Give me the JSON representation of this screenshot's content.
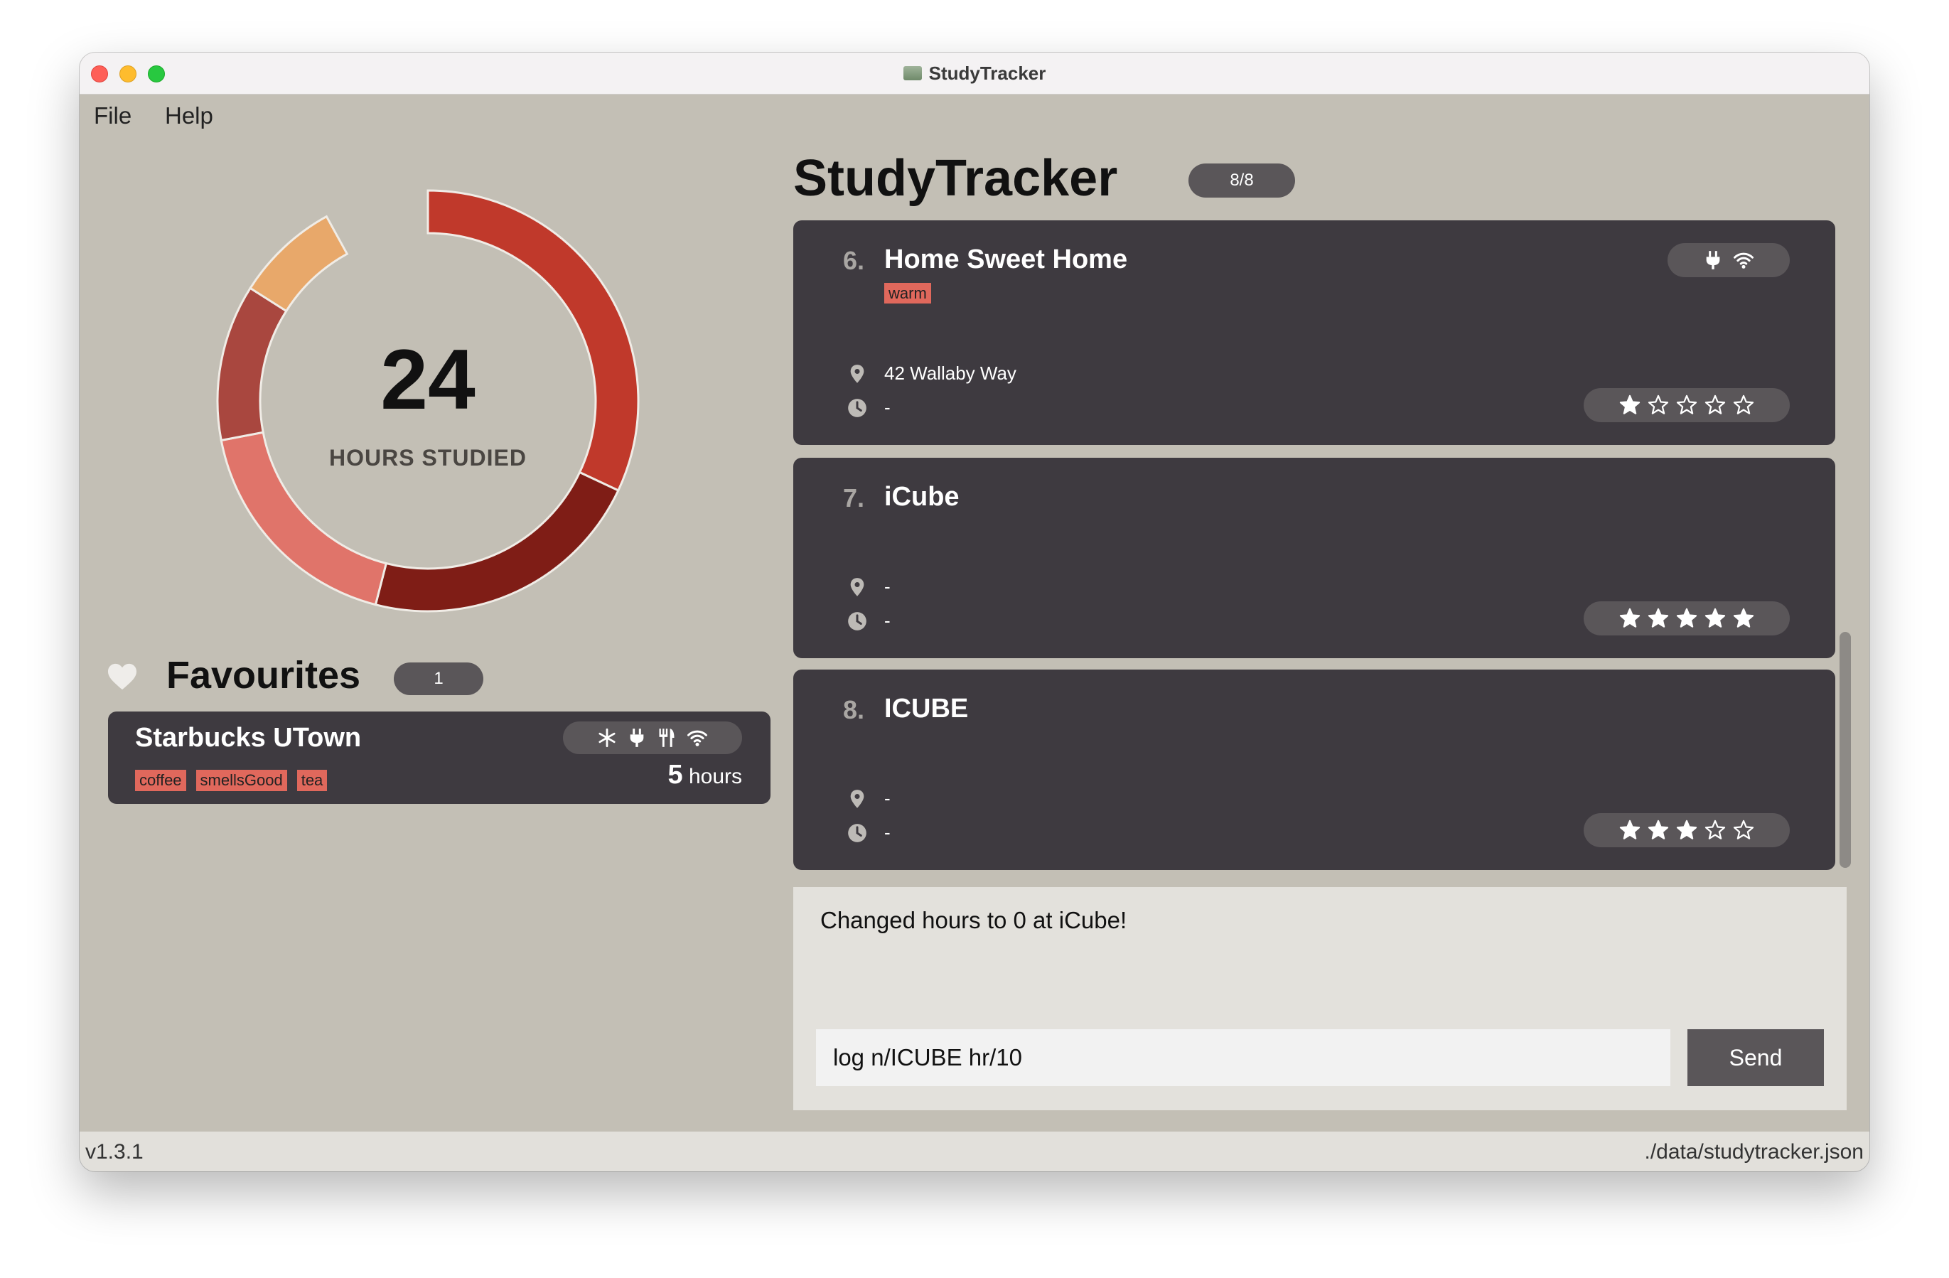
{
  "window": {
    "title": "StudyTracker"
  },
  "menu": {
    "file": "File",
    "help": "Help"
  },
  "summary": {
    "hours": "24",
    "caption": "HOURS STUDIED",
    "segments": [
      {
        "color": "#c0392b",
        "fraction": 0.32
      },
      {
        "color": "#7f1d16",
        "fraction": 0.22
      },
      {
        "color": "#e0746a",
        "fraction": 0.18
      },
      {
        "color": "#a9473f",
        "fraction": 0.12
      },
      {
        "color": "#e8a86a",
        "fraction": 0.08
      }
    ]
  },
  "favourites": {
    "title": "Favourites",
    "count": "1",
    "items": [
      {
        "name": "Starbucks UTown",
        "tags": [
          "coffee",
          "smellsGood",
          "tea"
        ],
        "hours": "5",
        "hours_label": "hours",
        "amenities": [
          "snowflake-icon",
          "plug-icon",
          "food-icon",
          "wifi-icon"
        ]
      }
    ]
  },
  "list": {
    "title": "StudyTracker",
    "count": "8/8",
    "cards": [
      {
        "index": "6.",
        "name": "Home Sweet Home",
        "tag": "warm",
        "location": "42 Wallaby Way",
        "time": "-",
        "rating": 1,
        "amenities": [
          "plug-icon",
          "wifi-icon"
        ]
      },
      {
        "index": "7.",
        "name": "iCube",
        "tag": "",
        "location": "-",
        "time": "-",
        "rating": 5,
        "amenities": []
      },
      {
        "index": "8.",
        "name": "ICUBE",
        "tag": "",
        "location": "-",
        "time": "-",
        "rating": 3,
        "amenities": []
      }
    ]
  },
  "result": {
    "text": "Changed hours to 0 at iCube!"
  },
  "command": {
    "value": "log n/ICUBE hr/10",
    "send_label": "Send"
  },
  "status": {
    "version": "v1.3.1",
    "path": "./data/studytracker.json"
  },
  "colors": {
    "card": "#3e3a40",
    "tag": "#e0685c",
    "background": "#c3bfb5"
  }
}
